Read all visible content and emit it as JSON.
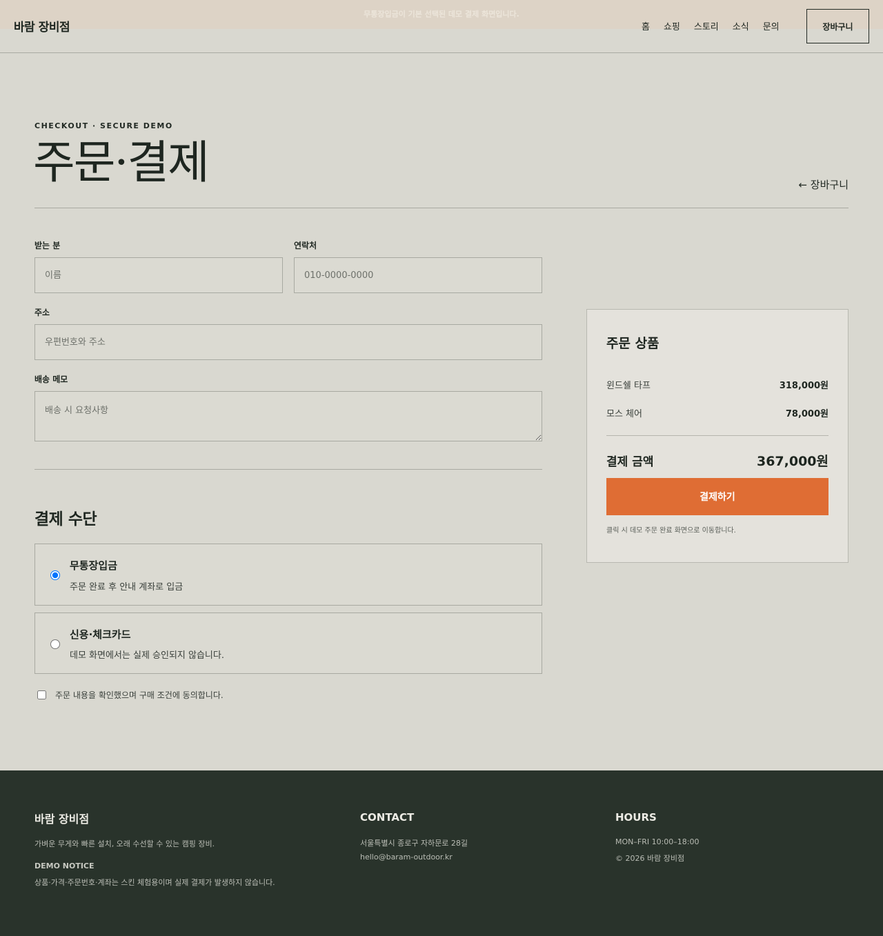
{
  "header": {
    "notice": "무통장입금이 기본 선택된 데모 결제 화면입니다.",
    "brand": "바람 장비점",
    "nav": [
      "홈",
      "쇼핑",
      "스토리",
      "소식",
      "문의"
    ],
    "cart_label": "장바구니"
  },
  "page": {
    "eyebrow": "CHECKOUT · SECURE DEMO",
    "title": "주문·결제",
    "back_link": "← 장바구니"
  },
  "form": {
    "recipient_label": "받는 분",
    "recipient_placeholder": "이름",
    "phone_label": "연락처",
    "phone_placeholder": "010-0000-0000",
    "address_label": "주소",
    "address_placeholder": "우편번호와 주소",
    "memo_label": "배송 메모",
    "memo_placeholder": "배송 시 요청사항"
  },
  "payment": {
    "title": "결제 수단",
    "options": [
      {
        "title": "무통장입금",
        "desc": "주문 완료 후 안내 계좌로 입금",
        "selected": true
      },
      {
        "title": "신용·체크카드",
        "desc": "데모 화면에서는 실제 승인되지 않습니다.",
        "selected": false
      }
    ],
    "agree_label": "주문 내용을 확인했으며 구매 조건에 동의합니다."
  },
  "summary": {
    "title": "주문 상품",
    "items": [
      {
        "name": "윈드쉘 타프",
        "price": "318,000원"
      },
      {
        "name": "모스 체어",
        "price": "78,000원"
      }
    ],
    "total_label": "결제 금액",
    "total_value": "367,000원",
    "pay_button": "결제하기",
    "note": "클릭 시 데모 주문 완료 화면으로 이동합니다."
  },
  "footer": {
    "brand": "바람 장비점",
    "tagline": "가벼운 무게와 빠른 설치, 오래 수선할 수 있는 캠핑 장비.",
    "notice_title": "DEMO NOTICE",
    "notice_text": "상품·가격·주문번호·계좌는 스킨 체험용이며 실제 결제가 발생하지 않습니다.",
    "contact_title": "CONTACT",
    "address": "서울특별시 종로구 자하문로 28길",
    "email": "hello@baram-outdoor.kr",
    "hours_title": "HOURS",
    "hours": "MON–FRI 10:00–18:00",
    "copyright": "© 2026 바람 장비점"
  }
}
